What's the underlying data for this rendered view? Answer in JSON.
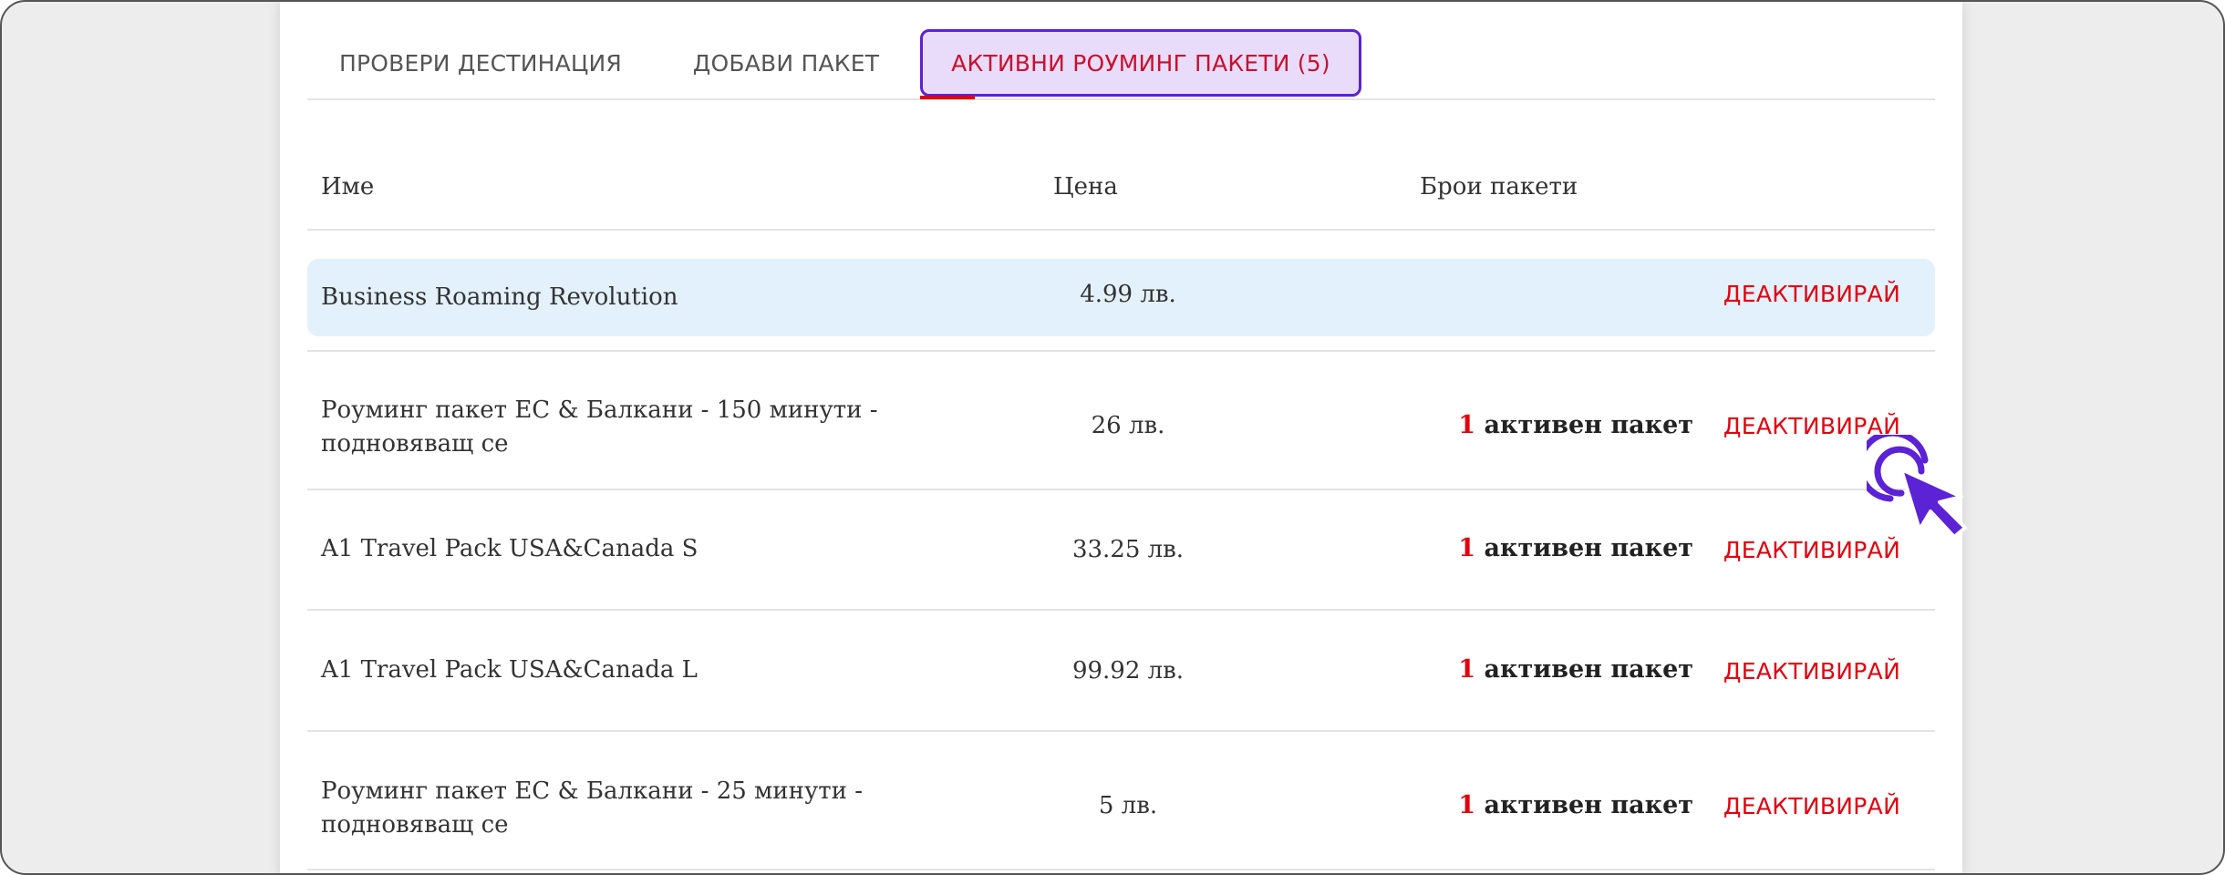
{
  "tabs": [
    {
      "label": "ПРОВЕРИ ДЕСТИНАЦИЯ"
    },
    {
      "label": "ДОБАВИ ПАКЕТ"
    },
    {
      "label": "АКТИВНИ РОУМИНГ ПАКЕТИ (5)"
    }
  ],
  "table": {
    "headers": {
      "name": "Име",
      "price": "Цена",
      "count": "Брои пакети"
    },
    "rows": [
      {
        "name": "Business Roaming Revolution",
        "price": "4.99 лв.",
        "count_num": "",
        "count_text": "",
        "action": "ДЕАКТИВИРАЙ"
      },
      {
        "name": "Роуминг пакет ЕС & Балкани - 150 минути - подновяващ се",
        "price": "26 лв.",
        "count_num": "1",
        "count_text": "активен пакет",
        "action": "ДЕАКТИВИРАЙ"
      },
      {
        "name": "A1 Travel Pack USA&Canada S",
        "price": "33.25 лв.",
        "count_num": "1",
        "count_text": "активен пакет",
        "action": "ДЕАКТИВИРАЙ"
      },
      {
        "name": "A1 Travel Pack USA&Canada L",
        "price": "99.92 лв.",
        "count_num": "1",
        "count_text": "активен пакет",
        "action": "ДЕАКТИВИРАЙ"
      },
      {
        "name": "Роуминг пакет ЕС & Балкани - 25 минути - подновяващ се",
        "price": "5 лв.",
        "count_num": "1",
        "count_text": "активен пакет",
        "action": "ДЕАКТИВИРАЙ"
      }
    ]
  },
  "colors": {
    "accent": "#e1000f",
    "active_tab_bg": "#e8dcfa",
    "active_tab_border": "#5b22d6",
    "highlight_row": "#e3f1fc",
    "cursor": "#5b22d6"
  },
  "icons": {
    "cursor": "click-pointer-icon"
  }
}
